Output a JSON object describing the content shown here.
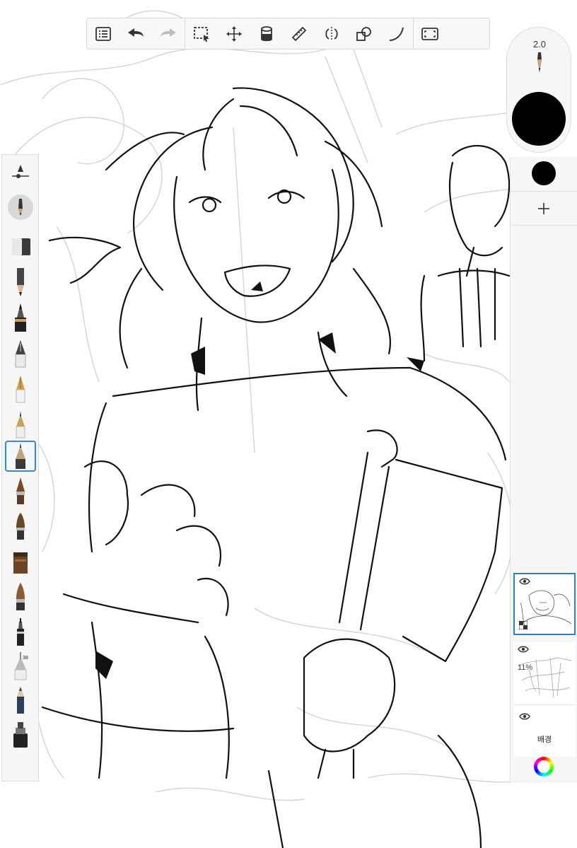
{
  "toolbar": {
    "groups": [
      [
        "list-icon",
        "undo-icon",
        "redo-icon"
      ],
      [
        "selection-icon",
        "transform-icon",
        "fill-icon",
        "ruler-icon",
        "symmetry-icon",
        "shape-icon",
        "curve-icon"
      ],
      [
        "fullscreen-icon"
      ]
    ]
  },
  "brush": {
    "size_label": "2.0",
    "color": "#000000"
  },
  "layers": [
    {
      "name": "",
      "selected": true
    },
    {
      "name": "",
      "opacity_label": "11%"
    },
    {
      "name": "배경"
    }
  ],
  "left_palette": {
    "items": [
      "brush-settings-icon",
      "current-brush-icon",
      "eraser-icon",
      "pencil-icon",
      "marker-icon",
      "ink-pen-icon",
      "fountain-pen-icon",
      "technical-pen-icon",
      "fineliner-icon",
      "paintbrush-icon",
      "round-brush-icon",
      "airbrush-icon",
      "flat-brush-icon",
      "felt-tip-icon",
      "needle-pen-icon",
      "blue-pencil-icon",
      "stamp-brush-icon"
    ],
    "selected_index": 7,
    "size_tag": "38"
  },
  "colors": {
    "accent": "#2f7fc8",
    "panel_bg": "#f6f6f6",
    "ink": "#000000"
  }
}
